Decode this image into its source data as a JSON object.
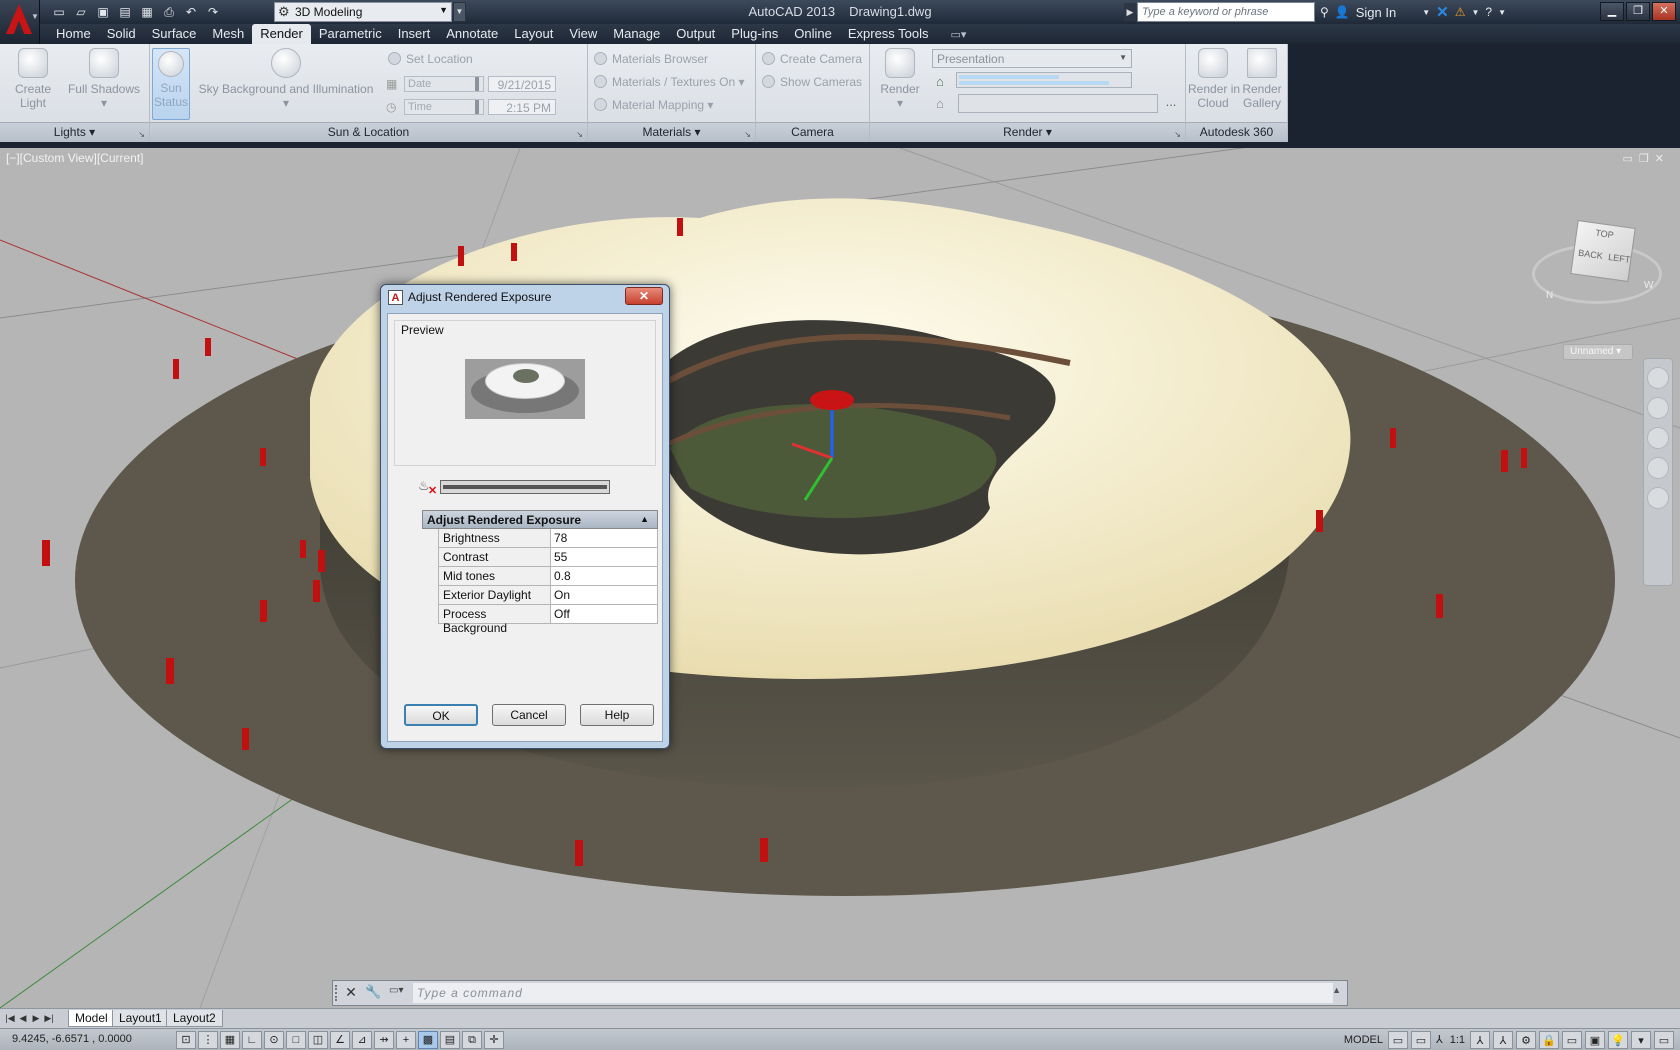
{
  "app": {
    "title_app": "AutoCAD 2013",
    "title_file": "Drawing1.dwg",
    "workspace": "3D Modeling",
    "search_placeholder": "Type a keyword or phrase",
    "sign_in": "Sign In"
  },
  "menu_tabs": [
    "Home",
    "Solid",
    "Surface",
    "Mesh",
    "Render",
    "Parametric",
    "Insert",
    "Annotate",
    "Layout",
    "View",
    "Manage",
    "Output",
    "Plug-ins",
    "Online",
    "Express Tools"
  ],
  "ribbon": {
    "lights": {
      "title": "Lights",
      "create_light": "Create\nLight",
      "full_shadows": "Full Shadows"
    },
    "sun": {
      "title": "Sun & Location",
      "sun_status": "Sun\nStatus",
      "sky": "Sky Background and Illumination",
      "set_location": "Set Location",
      "date_label": "Date",
      "date_value": "9/21/2015",
      "time_label": "Time",
      "time_value": "2:15 PM"
    },
    "materials": {
      "title": "Materials",
      "browser": "Materials Browser",
      "textures": "Materials / Textures On",
      "mapping": "Material Mapping"
    },
    "camera": {
      "title": "Camera",
      "create": "Create Camera",
      "show": "Show  Cameras"
    },
    "render": {
      "title": "Render",
      "render": "Render",
      "preset": "Presentation"
    },
    "a360": {
      "title": "Autodesk 360",
      "cloud": "Render in\nCloud",
      "gallery": "Render\nGallery"
    }
  },
  "viewport": {
    "label": "[−][Custom View][Current]",
    "unnamed": "Unnamed",
    "cube_back": "BACK",
    "cube_left": "LEFT",
    "cube_top": "TOP",
    "compass_n": "N",
    "compass_w": "W"
  },
  "dialog": {
    "title": "Adjust Rendered Exposure",
    "preview_label": "Preview",
    "section": "Adjust Rendered Exposure",
    "props": [
      {
        "key": "Brightness",
        "value": "78"
      },
      {
        "key": "Contrast",
        "value": "55"
      },
      {
        "key": "Mid tones",
        "value": "0.8"
      },
      {
        "key": "Exterior Daylight",
        "value": "On"
      },
      {
        "key": "Process Background",
        "value": "Off"
      }
    ],
    "ok": "OK",
    "cancel": "Cancel",
    "help": "Help"
  },
  "command": {
    "placeholder": "Type  a  command"
  },
  "layouts": [
    "Model",
    "Layout1",
    "Layout2"
  ],
  "status": {
    "coords": "9.4245, -6.6571 , 0.0000",
    "model": "MODEL",
    "scale": "1:1"
  }
}
